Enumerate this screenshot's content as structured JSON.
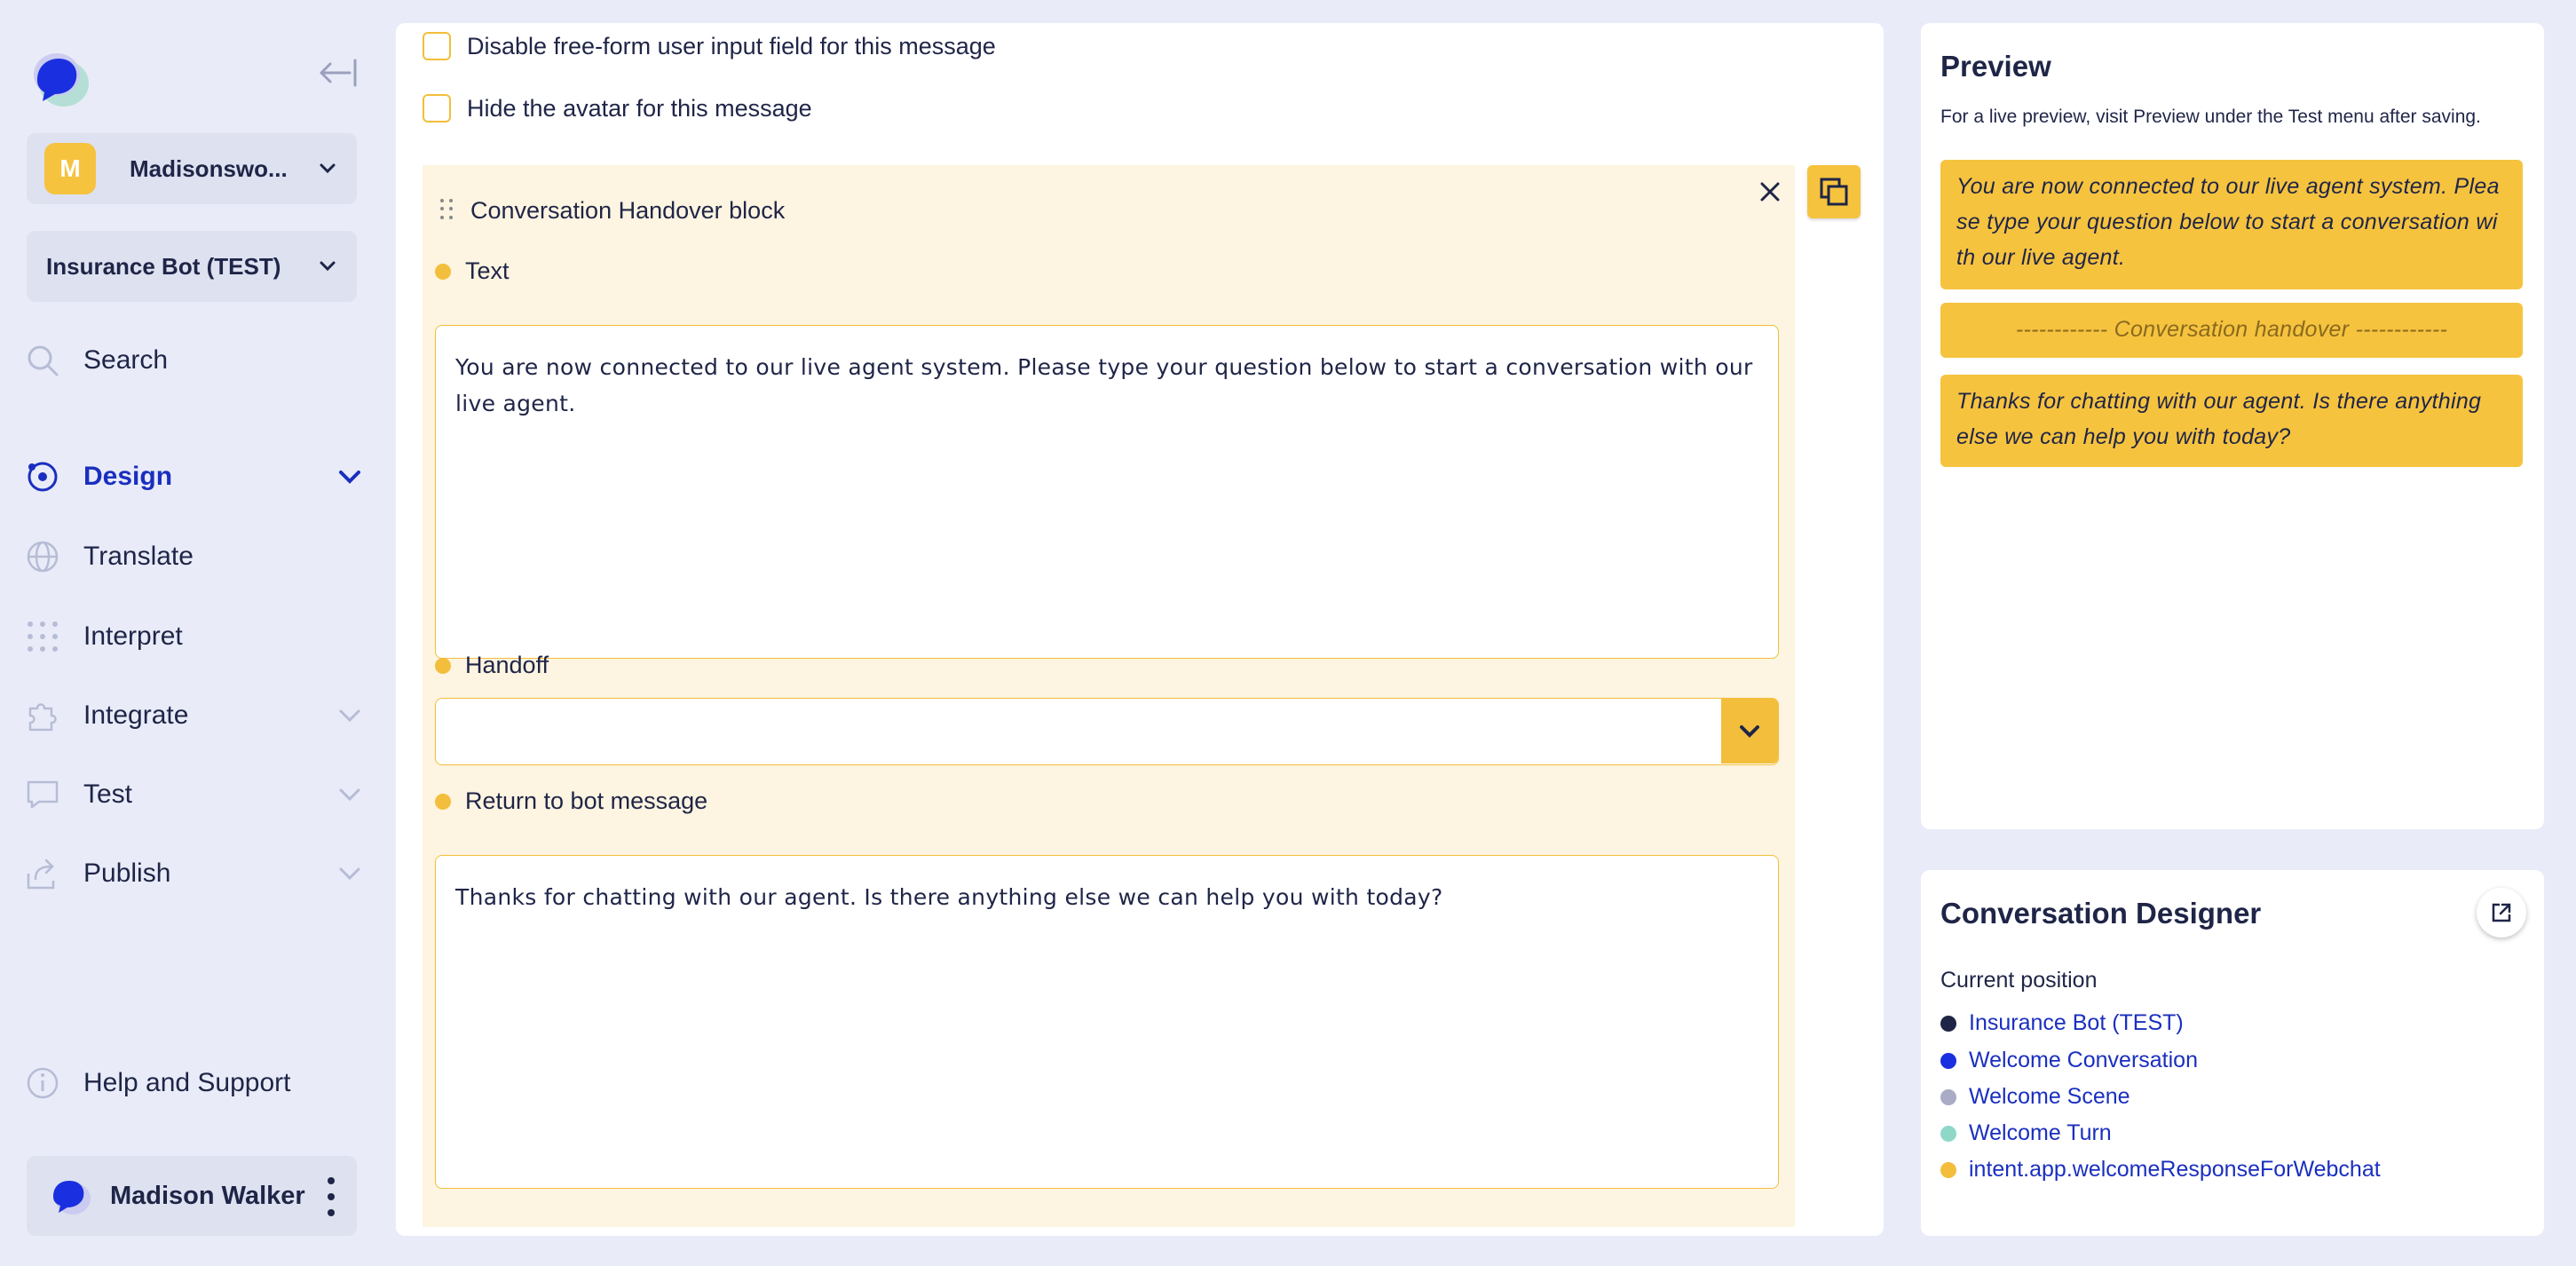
{
  "sidebar": {
    "org": {
      "initial": "M",
      "name": "Madisonswo..."
    },
    "bot": {
      "name": "Insurance Bot (TEST)"
    },
    "nav": {
      "search": "Search",
      "design": "Design",
      "translate": "Translate",
      "interpret": "Interpret",
      "integrate": "Integrate",
      "test": "Test",
      "publish": "Publish",
      "help": "Help and Support"
    },
    "user": {
      "name": "Madison Walker"
    }
  },
  "main": {
    "checkboxes": {
      "disable_input": "Disable free-form user input field for this message",
      "hide_avatar": "Hide the avatar for this message"
    },
    "block": {
      "title": "Conversation Handover block",
      "text_label": "Text",
      "text_value": "You are now connected to our live agent system. Please type your question below to start a conversation with our live agent.",
      "handoff_label": "Handoff",
      "handoff_value": "",
      "return_label": "Return to bot message",
      "return_value": "Thanks for chatting with our agent. Is there anything else we can help you with today?"
    }
  },
  "preview": {
    "title": "Preview",
    "subtitle": "For a live preview, visit Preview under the Test menu after saving.",
    "bubbles": [
      "You are now connected to our live agent system. Plea se type your question below to start a conversation wi th our live agent.",
      "------------ Conversation handover ------------",
      "Thanks for chatting with our agent. Is there anything else we can help you with today?"
    ]
  },
  "designer": {
    "title": "Conversation Designer",
    "position_label": "Current position",
    "items": [
      {
        "label": "Insurance Bot (TEST)",
        "color": "#1f2547"
      },
      {
        "label": "Welcome Conversation",
        "color": "#1a2fdf"
      },
      {
        "label": "Welcome Scene",
        "color": "#a9acc4"
      },
      {
        "label": "Welcome Turn",
        "color": "#8fd8c8"
      },
      {
        "label": "intent.app.welcomeResponseForWebchat",
        "color": "#f3be3b"
      }
    ]
  },
  "colors": {
    "accent": "#f6c33f",
    "link": "#1a2fbf",
    "background": "#e9ecf8",
    "text": "#1f2547"
  }
}
